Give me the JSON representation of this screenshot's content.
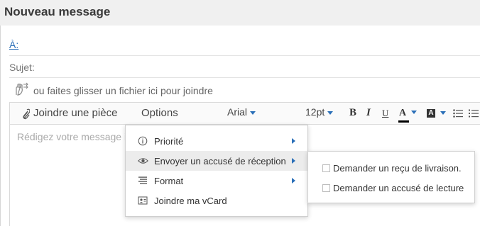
{
  "window": {
    "title": "Nouveau message"
  },
  "fields": {
    "to_label": "À:",
    "subject_label": "Sujet:",
    "drop_hint": "ou faites glisser un fichier ici pour joindre"
  },
  "toolbar": {
    "attach_label": "Joindre une pièce",
    "options_label": "Options",
    "font_family": "Arial",
    "font_size": "12pt",
    "bold": "B",
    "italic": "I",
    "underline": "U",
    "font_color": "A",
    "highlight_color": "A"
  },
  "editor": {
    "placeholder": "Rédigez votre message i"
  },
  "options_menu": {
    "items": [
      {
        "label": "Priorité",
        "icon": "info-circle-icon",
        "has_submenu": true
      },
      {
        "label": "Envoyer un accusé de réception",
        "icon": "eye-icon",
        "has_submenu": true,
        "active": true
      },
      {
        "label": "Format",
        "icon": "align-lines-icon",
        "has_submenu": true
      },
      {
        "label": "Joindre ma vCard",
        "icon": "vcard-icon",
        "has_submenu": false
      }
    ]
  },
  "receipt_submenu": {
    "items": [
      {
        "label": "Demander un reçu de livraison.",
        "checked": false
      },
      {
        "label": "Demander un accusé de lecture",
        "checked": false
      }
    ]
  },
  "colors": {
    "link": "#2a6fb8",
    "menu_active": "#ececec",
    "titlebar": "#f0f0f0"
  }
}
